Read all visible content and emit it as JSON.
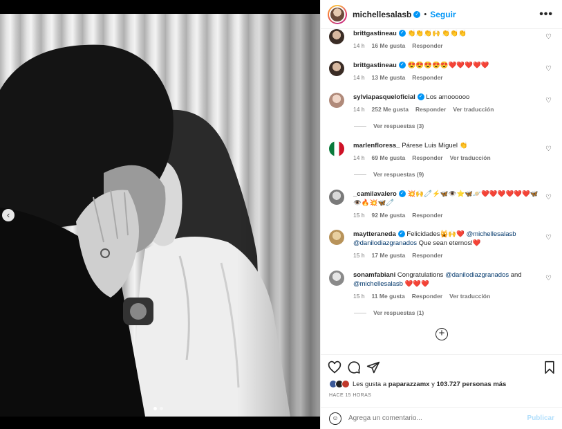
{
  "header": {
    "username": "michellesalasb",
    "separator": "•",
    "follow": "Seguir",
    "more": "•••"
  },
  "comments": [
    {
      "user": "brittgastineau",
      "verified": true,
      "text": "👏👏👏🙌 👏👏👏",
      "time": "14 h",
      "likes": "16 Me gusta",
      "reply": "Responder",
      "translate": ""
    },
    {
      "user": "brittgastineau",
      "verified": true,
      "text": "😍😍😍😍😍❤️❤️❤️❤️❤️",
      "time": "14 h",
      "likes": "13 Me gusta",
      "reply": "Responder",
      "translate": ""
    },
    {
      "user": "sylviapasqueloficial",
      "verified": true,
      "text": "Los amoooooo",
      "time": "14 h",
      "likes": "252 Me gusta",
      "reply": "Responder",
      "translate": "Ver traducción",
      "replies": "Ver respuestas (3)"
    },
    {
      "user": "marlenfloress_",
      "verified": false,
      "text": "Párese Luis Miguel 👏",
      "time": "14 h",
      "likes": "69 Me gusta",
      "reply": "Responder",
      "translate": "Ver traducción",
      "replies": "Ver respuestas (9)"
    },
    {
      "user": "_camilavalero",
      "verified": true,
      "text": "💥🙌🧷⚡🦋👁️⭐🦋🪐❤️❤️❤️❤️❤️❤️🦋👁️🔥💥🦋🧷",
      "time": "15 h",
      "likes": "92 Me gusta",
      "reply": "Responder",
      "translate": ""
    },
    {
      "user": "maytteraneda",
      "verified": true,
      "text_parts": [
        "Felicidades🙀🙌❤️ ",
        "@michellesalasb",
        " ",
        "@danilodiazgranados",
        " Que sean eternos!❤️"
      ],
      "time": "15 h",
      "likes": "17 Me gusta",
      "reply": "Responder",
      "translate": ""
    },
    {
      "user": "sonamfabiani",
      "verified": false,
      "text_parts": [
        "Congratulations ",
        "@danilodiazgranados",
        " and ",
        "@michellesalasb",
        " ❤️❤️❤️"
      ],
      "time": "15 h",
      "likes": "11 Me gusta",
      "reply": "Responder",
      "translate": "Ver traducción",
      "replies": "Ver respuestas (1)"
    }
  ],
  "likes_row": {
    "prefix": "Les gusta a ",
    "user": "paparazzamx",
    "middle": " y ",
    "count": "103.727 personas más"
  },
  "time_ago": "HACE 15 HORAS",
  "add_comment": {
    "placeholder": "Agrega un comentario...",
    "publish": "Publicar"
  },
  "colors": {
    "accent": "#0095f6",
    "mention": "#00376b",
    "muted": "#737373",
    "publish_disabled": "#b2dffc"
  }
}
